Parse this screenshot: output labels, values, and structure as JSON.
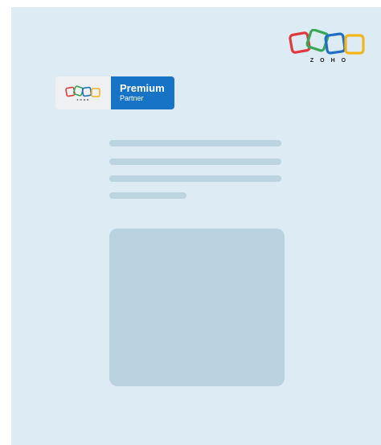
{
  "brand": {
    "logo_word": "ZOHO",
    "logo_colors": [
      "#e03a3e",
      "#3aa657",
      "#1f6fc5",
      "#f4b51c"
    ]
  },
  "partner_badge": {
    "title": "Premium",
    "subtitle": "Partner",
    "mini_logo_word": "ZOHO",
    "accent_color": "#1673c6"
  },
  "content": {
    "text_placeholder_lines": 4,
    "has_media_placeholder": true
  },
  "colors": {
    "page_background": "#dcebf4",
    "placeholder": "#bcd4e0",
    "media_placeholder": "#b8d3df"
  }
}
